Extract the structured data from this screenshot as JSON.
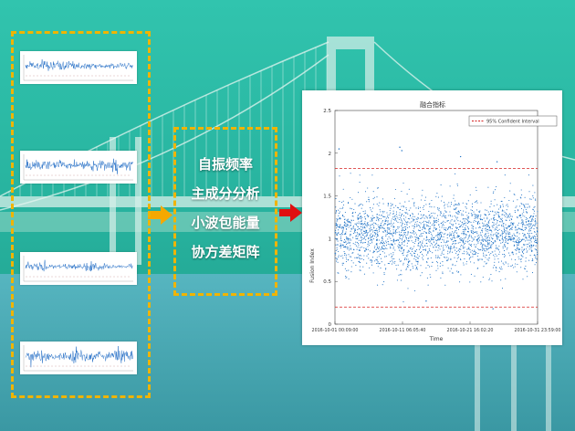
{
  "colors": {
    "sky": "#29b8a4",
    "water": "#1f9a88",
    "dashed_border": "#f0b400",
    "arrow_yellow": "#f5a800",
    "arrow_red": "#e01010",
    "scatter_blue": "#1a6fc4",
    "threshold_red": "#d62020"
  },
  "features": [
    "自振频率",
    "主成分分析",
    "小波包能量",
    "协方差矩阵"
  ],
  "signals": [
    {
      "name": "signal-1",
      "amplitude": 0.55
    },
    {
      "name": "signal-2",
      "amplitude": 0.7
    },
    {
      "name": "signal-3",
      "amplitude": 0.45
    },
    {
      "name": "signal-4",
      "amplitude": 0.8
    }
  ],
  "chart_data": {
    "type": "scatter",
    "title": "融合指标",
    "xlabel": "Time",
    "ylabel": "Fusion Index",
    "xticks": [
      "2016-10-01 00:09:00",
      "2016-10-11 06:05:40",
      "2016-10-21 16:02:20",
      "2016-10-31 23:59:00"
    ],
    "yticks": [
      "0",
      "0.5",
      "1",
      "1.5",
      "2",
      "2.5"
    ],
    "ylim": [
      0,
      2.5
    ],
    "legend": [
      {
        "label": "95% Confident Interval",
        "style": "dashed-red"
      }
    ],
    "legend_position": "top-right",
    "thresholds": [
      {
        "name": "upper",
        "value": 1.82
      },
      {
        "name": "lower",
        "value": 0.2
      }
    ],
    "point_distribution": {
      "center": 1.05,
      "spread": 0.42,
      "point_count": 2600,
      "outliers": [
        {
          "position": 0.02,
          "value": 2.05
        },
        {
          "position": 0.32,
          "value": 2.07
        },
        {
          "position": 0.33,
          "value": 2.03
        },
        {
          "position": 0.62,
          "value": 1.96
        },
        {
          "position": 0.8,
          "value": 1.9
        },
        {
          "position": 0.45,
          "value": 0.27
        },
        {
          "position": 0.78,
          "value": 0.18
        }
      ]
    }
  }
}
